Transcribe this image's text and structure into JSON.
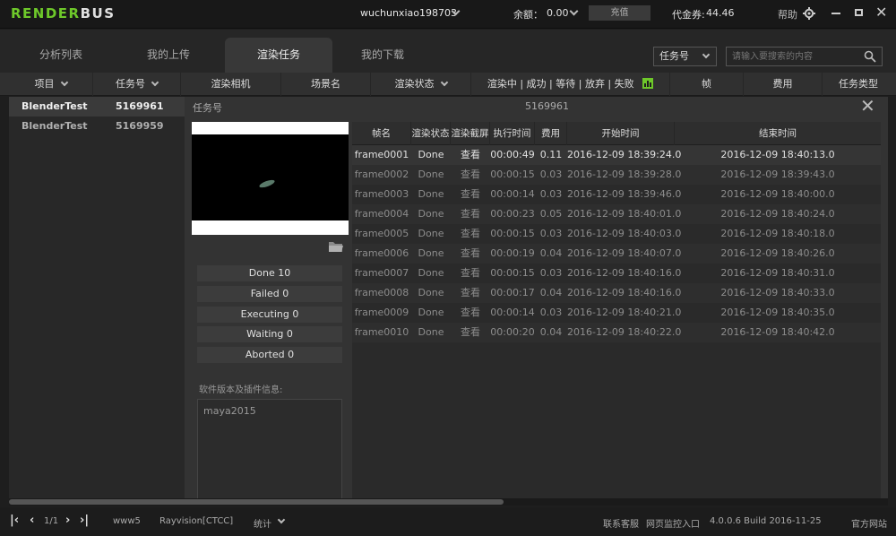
{
  "app": {
    "logo_prefix": "RENDER",
    "logo_suffix": "BUS",
    "username": "wuchunxiao198703",
    "balance_label": "余额：",
    "balance_value": "0.00",
    "recharge_label": "充值",
    "voucher_label": "代金券:",
    "voucher_value": "44.46",
    "help_label": "帮助"
  },
  "tabs": [
    {
      "label": "分析列表"
    },
    {
      "label": "我的上传"
    },
    {
      "label": "渲染任务"
    },
    {
      "label": "我的下载"
    }
  ],
  "search": {
    "type": "任务号",
    "placeholder": "请输入要搜索的内容"
  },
  "columns": {
    "project": "项目",
    "task_id": "任务号",
    "camera": "渲染相机",
    "scene": "场景名",
    "status": "渲染状态",
    "progress": "渲染中 | 成功 | 等待 | 放弃 | 失败",
    "frames": "帧",
    "cost": "费用",
    "task_type": "任务类型"
  },
  "jobs": [
    {
      "project": "BlenderTest",
      "task_id": "5169961"
    },
    {
      "project": "BlenderTest",
      "task_id": "5169959"
    }
  ],
  "detail": {
    "label": "任务号",
    "task_id": "5169961",
    "stats": [
      "Done  10",
      "Failed  0",
      "Executing  0",
      "Waiting  0",
      "Aborted  0"
    ],
    "software_label": "软件版本及插件信息:",
    "software": "maya2015"
  },
  "frame_table": {
    "headers": [
      "帧名",
      "渲染状态",
      "渲染截屏",
      "执行时间",
      "费用",
      "开始时间",
      "结束时间"
    ],
    "rows": [
      [
        "frame0001",
        "Done",
        "查看",
        "00:00:49",
        "0.11",
        "2016-12-09 18:39:24.0",
        "2016-12-09 18:40:13.0"
      ],
      [
        "frame0002",
        "Done",
        "查看",
        "00:00:15",
        "0.03",
        "2016-12-09 18:39:28.0",
        "2016-12-09 18:39:43.0"
      ],
      [
        "frame0003",
        "Done",
        "查看",
        "00:00:14",
        "0.03",
        "2016-12-09 18:39:46.0",
        "2016-12-09 18:40:00.0"
      ],
      [
        "frame0004",
        "Done",
        "查看",
        "00:00:23",
        "0.05",
        "2016-12-09 18:40:01.0",
        "2016-12-09 18:40:24.0"
      ],
      [
        "frame0005",
        "Done",
        "查看",
        "00:00:15",
        "0.03",
        "2016-12-09 18:40:03.0",
        "2016-12-09 18:40:18.0"
      ],
      [
        "frame0006",
        "Done",
        "查看",
        "00:00:19",
        "0.04",
        "2016-12-09 18:40:07.0",
        "2016-12-09 18:40:26.0"
      ],
      [
        "frame0007",
        "Done",
        "查看",
        "00:00:15",
        "0.03",
        "2016-12-09 18:40:16.0",
        "2016-12-09 18:40:31.0"
      ],
      [
        "frame0008",
        "Done",
        "查看",
        "00:00:17",
        "0.04",
        "2016-12-09 18:40:16.0",
        "2016-12-09 18:40:33.0"
      ],
      [
        "frame0009",
        "Done",
        "查看",
        "00:00:14",
        "0.03",
        "2016-12-09 18:40:21.0",
        "2016-12-09 18:40:35.0"
      ],
      [
        "frame0010",
        "Done",
        "查看",
        "00:00:20",
        "0.04",
        "2016-12-09 18:40:22.0",
        "2016-12-09 18:40:42.0"
      ]
    ]
  },
  "footer": {
    "pager": "1/1",
    "server": "www5",
    "platform": "Rayvision[CTCC]",
    "stats": "统计",
    "support": "联系客服",
    "monitor": "网页监控入口",
    "version": "4.0.0.6 Build 2016-11-25",
    "site": "官方网站"
  },
  "colors": {
    "brand_green": "#6ec82a",
    "background": "#1e1e1e",
    "panel": "#333333"
  }
}
